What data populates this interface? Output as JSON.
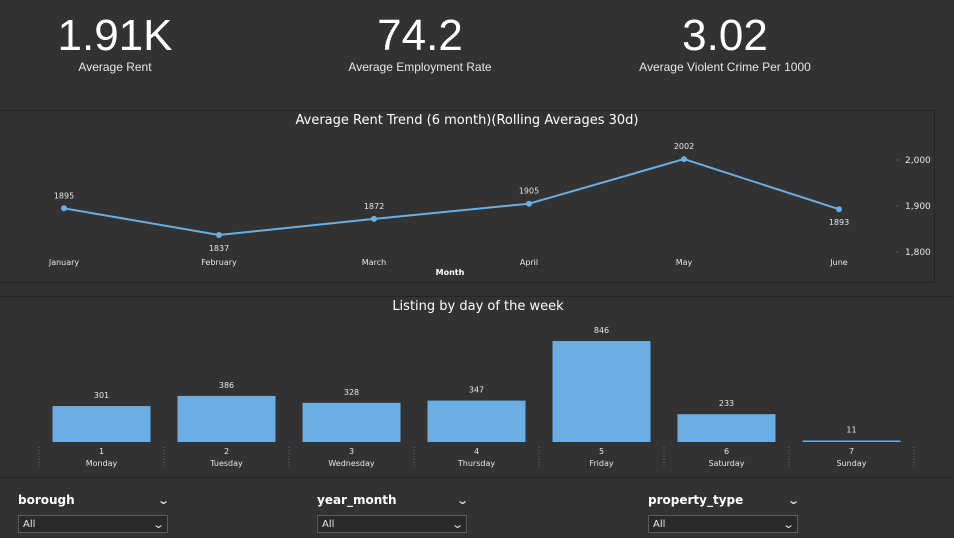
{
  "kpis": [
    {
      "value": "1.91K",
      "label": "Average Rent"
    },
    {
      "value": "74.2",
      "label": "Average Employment Rate"
    },
    {
      "value": "3.02",
      "label": "Average Violent Crime Per 1000"
    }
  ],
  "colors": {
    "background": "#323232",
    "series": "#6aaee3",
    "panel_border": "#252525"
  },
  "chart_data": [
    {
      "type": "line",
      "title": "Average Rent Trend (6 month)(Rolling Averages 30d)",
      "xlabel": "Month",
      "ylabel": "",
      "categories": [
        "January",
        "February",
        "March",
        "April",
        "May",
        "June"
      ],
      "values": [
        1895,
        1837,
        1872,
        1905,
        2002,
        1893
      ],
      "y_ticks": [
        "2,000",
        "1,900",
        "1,800"
      ],
      "ylim": [
        1775,
        2040
      ],
      "axis_position": "right",
      "grid": false
    },
    {
      "type": "bar",
      "title": "Listing by day of the week",
      "categories": [
        "1",
        "2",
        "3",
        "4",
        "5",
        "6",
        "7"
      ],
      "category_sublabels": [
        "Monday",
        "Tuesday",
        "Wednesday",
        "Thursday",
        "Friday",
        "Saturday",
        "Sunday"
      ],
      "values": [
        301,
        386,
        328,
        347,
        846,
        233,
        11
      ],
      "ylim": [
        0,
        846
      ],
      "grid": false
    }
  ],
  "slicers": [
    {
      "field": "borough",
      "value": "All"
    },
    {
      "field": "year_month",
      "value": "All"
    },
    {
      "field": "property_type",
      "value": "All"
    }
  ]
}
